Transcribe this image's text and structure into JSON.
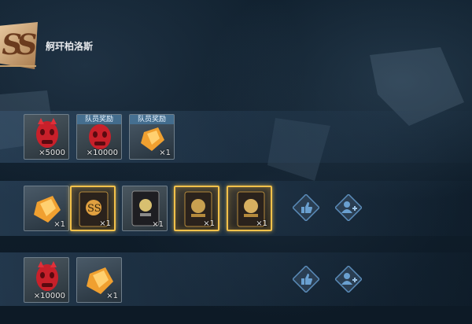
{
  "header": {
    "title": "舸玕柏洛斯",
    "logo_icon": "guild-emblem-icon"
  },
  "rows": [
    {
      "items": [
        {
          "icon": "red-mask-icon",
          "count": "×5000",
          "tag": ""
        },
        {
          "icon": "red-mask-icon",
          "count": "×10000",
          "tag": "队员奖励"
        },
        {
          "icon": "orange-crystal-icon",
          "count": "×1",
          "tag": "队员奖励"
        }
      ],
      "actions": []
    },
    {
      "items": [
        {
          "icon": "orange-crystal-icon",
          "count": "×1",
          "tag": ""
        },
        {
          "icon": "legendary-card-icon",
          "count": "×1",
          "tag": ""
        },
        {
          "icon": "rare-card-icon",
          "count": "×1",
          "tag": ""
        },
        {
          "icon": "legendary-card-icon",
          "count": "×1",
          "tag": ""
        },
        {
          "icon": "legendary-card-icon",
          "count": "×1",
          "tag": ""
        }
      ],
      "actions": [
        "thumbs-up-icon",
        "add-friend-icon"
      ]
    },
    {
      "items": [
        {
          "icon": "red-mask-icon",
          "count": "×10000",
          "tag": ""
        },
        {
          "icon": "orange-crystal-icon",
          "count": "×1",
          "tag": ""
        }
      ],
      "actions": [
        "thumbs-up-icon",
        "add-friend-icon"
      ]
    }
  ],
  "colors": {
    "gold_frame": "#f2c14a",
    "mask_red": "#c8202a",
    "crystal_orange": "#f0a030",
    "action_blue": "#5a8bb8"
  }
}
